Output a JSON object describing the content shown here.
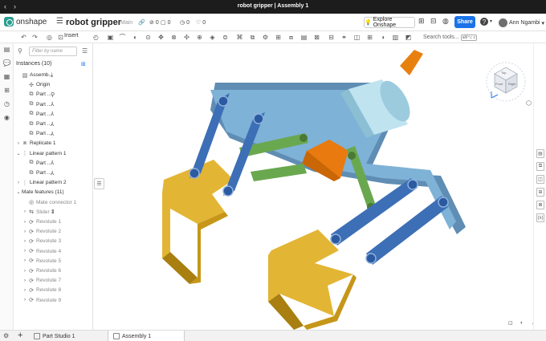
{
  "os": {
    "window_title": "robot gripper | Assembly 1"
  },
  "app": {
    "brand": "onshape",
    "doc_name": "robot gripper",
    "branch": "Main",
    "counts": {
      "versions": "0",
      "comments": "0",
      "likes": "0"
    },
    "explore_label": "Explore Onshape",
    "share_label": "Share",
    "user_name": "Ann Ngambi",
    "help_label": "?"
  },
  "toolbar": {
    "insert_label": "Insert",
    "search_placeholder": "Search tools...",
    "search_shortcut": "alt/⌥ c"
  },
  "panel": {
    "filter_placeholder": "Filter by name",
    "instances_title": "Instances (10)",
    "tree": [
      {
        "label": "Assemb...",
        "indent": 0,
        "caret": "",
        "icon": "assembly-icon",
        "status": "⤓",
        "dim": false
      },
      {
        "label": "Origin",
        "indent": 1,
        "caret": "",
        "icon": "origin-icon",
        "status": "",
        "dim": false
      },
      {
        "label": "Part ...",
        "indent": 1,
        "caret": "",
        "icon": "part-icon",
        "status": "⚲",
        "dim": false
      },
      {
        "label": "Part ...",
        "indent": 1,
        "caret": "",
        "icon": "part-icon",
        "status": "⅄",
        "dim": false
      },
      {
        "label": "Part ...",
        "indent": 1,
        "caret": "",
        "icon": "part-icon",
        "status": "⅄",
        "dim": false
      },
      {
        "label": "Part ...",
        "indent": 1,
        "caret": "",
        "icon": "part-icon",
        "status": "⅄",
        "dim": false
      },
      {
        "label": "Part ...",
        "indent": 1,
        "caret": "",
        "icon": "part-icon",
        "status": "⅄",
        "dim": false
      },
      {
        "label": "Replicate 1",
        "indent": 0,
        "caret": "›",
        "icon": "replicate-icon",
        "status": "",
        "dim": false
      },
      {
        "label": "Linear pattern 1",
        "indent": 0,
        "caret": "⌄",
        "icon": "linear-pattern-icon",
        "status": "",
        "dim": false
      },
      {
        "label": "Part ...",
        "indent": 1,
        "caret": "",
        "icon": "part-icon",
        "status": "⅄",
        "dim": false
      },
      {
        "label": "Part ...",
        "indent": 1,
        "caret": "",
        "icon": "part-icon",
        "status": "⅄",
        "dim": false
      },
      {
        "label": "Linear pattern 2",
        "indent": 0,
        "caret": "›",
        "icon": "linear-pattern-icon",
        "status": "",
        "dim": false
      },
      {
        "label": "Mate features (11)",
        "indent": 0,
        "caret": "⌄",
        "icon": "",
        "status": "",
        "dim": false
      },
      {
        "label": "Mate connector 1",
        "indent": 1,
        "caret": "",
        "icon": "mate-connector-icon",
        "status": "",
        "dim": true
      },
      {
        "label": "Slider 1",
        "indent": 1,
        "caret": "›",
        "icon": "slider-icon",
        "status": "⇕",
        "dim": true
      },
      {
        "label": "Revolute 1",
        "indent": 1,
        "caret": "›",
        "icon": "revolute-icon",
        "status": "",
        "dim": true
      },
      {
        "label": "Revolute 2",
        "indent": 1,
        "caret": "›",
        "icon": "revolute-icon",
        "status": "",
        "dim": true
      },
      {
        "label": "Revolute 3",
        "indent": 1,
        "caret": "›",
        "icon": "revolute-icon",
        "status": "",
        "dim": true
      },
      {
        "label": "Revolute 4",
        "indent": 1,
        "caret": "›",
        "icon": "revolute-icon",
        "status": "",
        "dim": true
      },
      {
        "label": "Revolute 5",
        "indent": 1,
        "caret": "›",
        "icon": "revolute-icon",
        "status": "",
        "dim": true
      },
      {
        "label": "Revolute 6",
        "indent": 1,
        "caret": "›",
        "icon": "revolute-icon",
        "status": "",
        "dim": true
      },
      {
        "label": "Revolute 7",
        "indent": 1,
        "caret": "›",
        "icon": "revolute-icon",
        "status": "",
        "dim": true
      },
      {
        "label": "Revolute 8",
        "indent": 1,
        "caret": "›",
        "icon": "revolute-icon",
        "status": "",
        "dim": true
      },
      {
        "label": "Revolute 9",
        "indent": 1,
        "caret": "›",
        "icon": "revolute-icon",
        "status": "",
        "dim": true
      }
    ]
  },
  "viewcube": {
    "top_label": "Top",
    "front_label": "Front",
    "right_label": "Right"
  },
  "tabs": [
    {
      "label": "Part Studio 1",
      "active": false
    },
    {
      "label": "Assembly 1",
      "active": true
    }
  ],
  "colors": {
    "base_plate": "#6fa0c8",
    "link_blue": "#3d6fb6",
    "link_green": "#6aa84f",
    "finger_yellow": "#e3b534",
    "shaft_light": "#a9d4e4",
    "rod_orange": "#e8800f",
    "share_blue": "#1a73e8"
  }
}
